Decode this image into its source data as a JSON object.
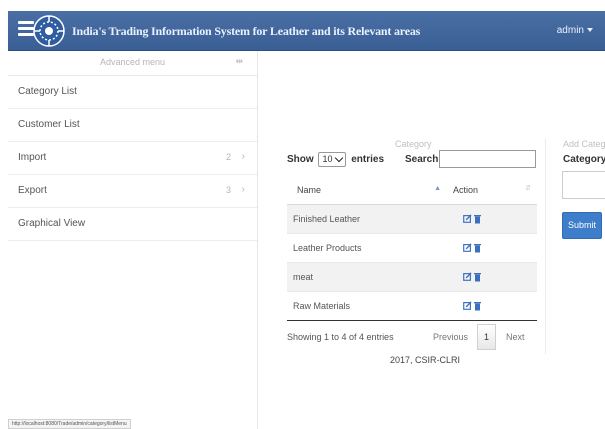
{
  "header": {
    "title": "India's Trading Information System for Leather and its Relevant areas",
    "user": "admin"
  },
  "sidebar": {
    "title": "Advanced menu",
    "pin": "⇹",
    "items": [
      {
        "label": "Category List",
        "count": ""
      },
      {
        "label": "Customer List",
        "count": ""
      },
      {
        "label": "Import",
        "count": "2"
      },
      {
        "label": "Export",
        "count": "3"
      },
      {
        "label": "Graphical View",
        "count": ""
      }
    ]
  },
  "status_url": "http://localhost:8080/Trade/admin/category/listMenu",
  "category_panel": {
    "title": "Category",
    "length": {
      "show": "Show",
      "value": "10",
      "entries": "entries"
    },
    "search_label": "Search:",
    "search_value": "",
    "columns": [
      "Name",
      "Action"
    ],
    "rows": [
      {
        "name": "Finished Leather"
      },
      {
        "name": "Leather Products"
      },
      {
        "name": "meat"
      },
      {
        "name": "Raw Materials"
      }
    ],
    "info": "Showing 1 to 4 of 4 entries",
    "pager": {
      "previous": "Previous",
      "current": "1",
      "next": "Next"
    }
  },
  "footer": "2017, CSIR-CLRI",
  "add_panel": {
    "title": "Add Category",
    "label": "Category*",
    "value": "",
    "submit": "Submit"
  },
  "colors": {
    "header": "#4a6fa5",
    "submit": "#3d7dc9",
    "edit_icon": "#3d6fc0",
    "delete_icon": "#3d6fc0"
  },
  "icons": [
    "menu-icon",
    "logo-icon",
    "caret-down-icon",
    "chevron-right-icon",
    "edit-icon",
    "trash-icon",
    "sort-icon"
  ]
}
